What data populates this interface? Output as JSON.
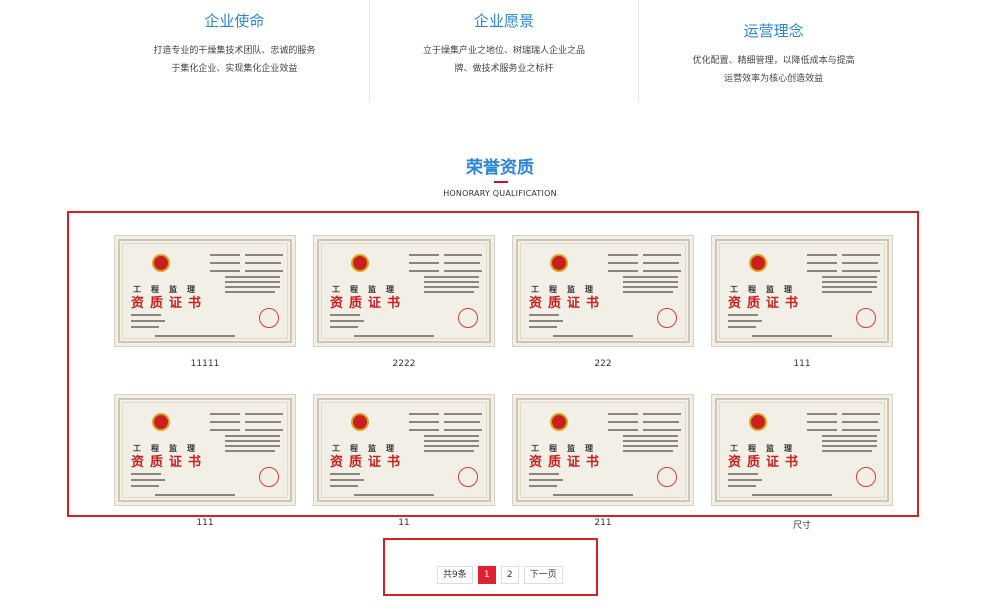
{
  "info_columns": [
    {
      "title": "企业使命",
      "lines": [
        "打造专业的干燥集技术团队、忠诚的服务",
        "于集化企业、实现集化企业效益"
      ]
    },
    {
      "title": "企业愿景",
      "lines": [
        "立于燥集产业之地位、树瑞瑞人企业之品",
        "牌、做技术服务业之标杆"
      ]
    },
    {
      "title": "运营理念",
      "lines": [
        "优化配置、精细管理，以降低成本与提高",
        "运营效率为核心创造效益"
      ]
    }
  ],
  "section": {
    "title": "荣誉资质",
    "subtitle": "HONORARY QUALIFICATION"
  },
  "certificate_text": {
    "line1": "工程监理",
    "line2": "资质证书"
  },
  "certificates": [
    {
      "caption": "11111"
    },
    {
      "caption": "2222"
    },
    {
      "caption": "222"
    },
    {
      "caption": "111"
    },
    {
      "caption": "111"
    },
    {
      "caption": "11"
    },
    {
      "caption": "211"
    },
    {
      "caption": "尺寸"
    }
  ],
  "pagination": {
    "total_label": "共9条",
    "pages": [
      "1",
      "2"
    ],
    "current_page": "1",
    "next_label": "下一页"
  },
  "colors": {
    "accent_blue": "#2a86d8",
    "highlight_red": "#d32222",
    "active_page": "#e0212f"
  }
}
